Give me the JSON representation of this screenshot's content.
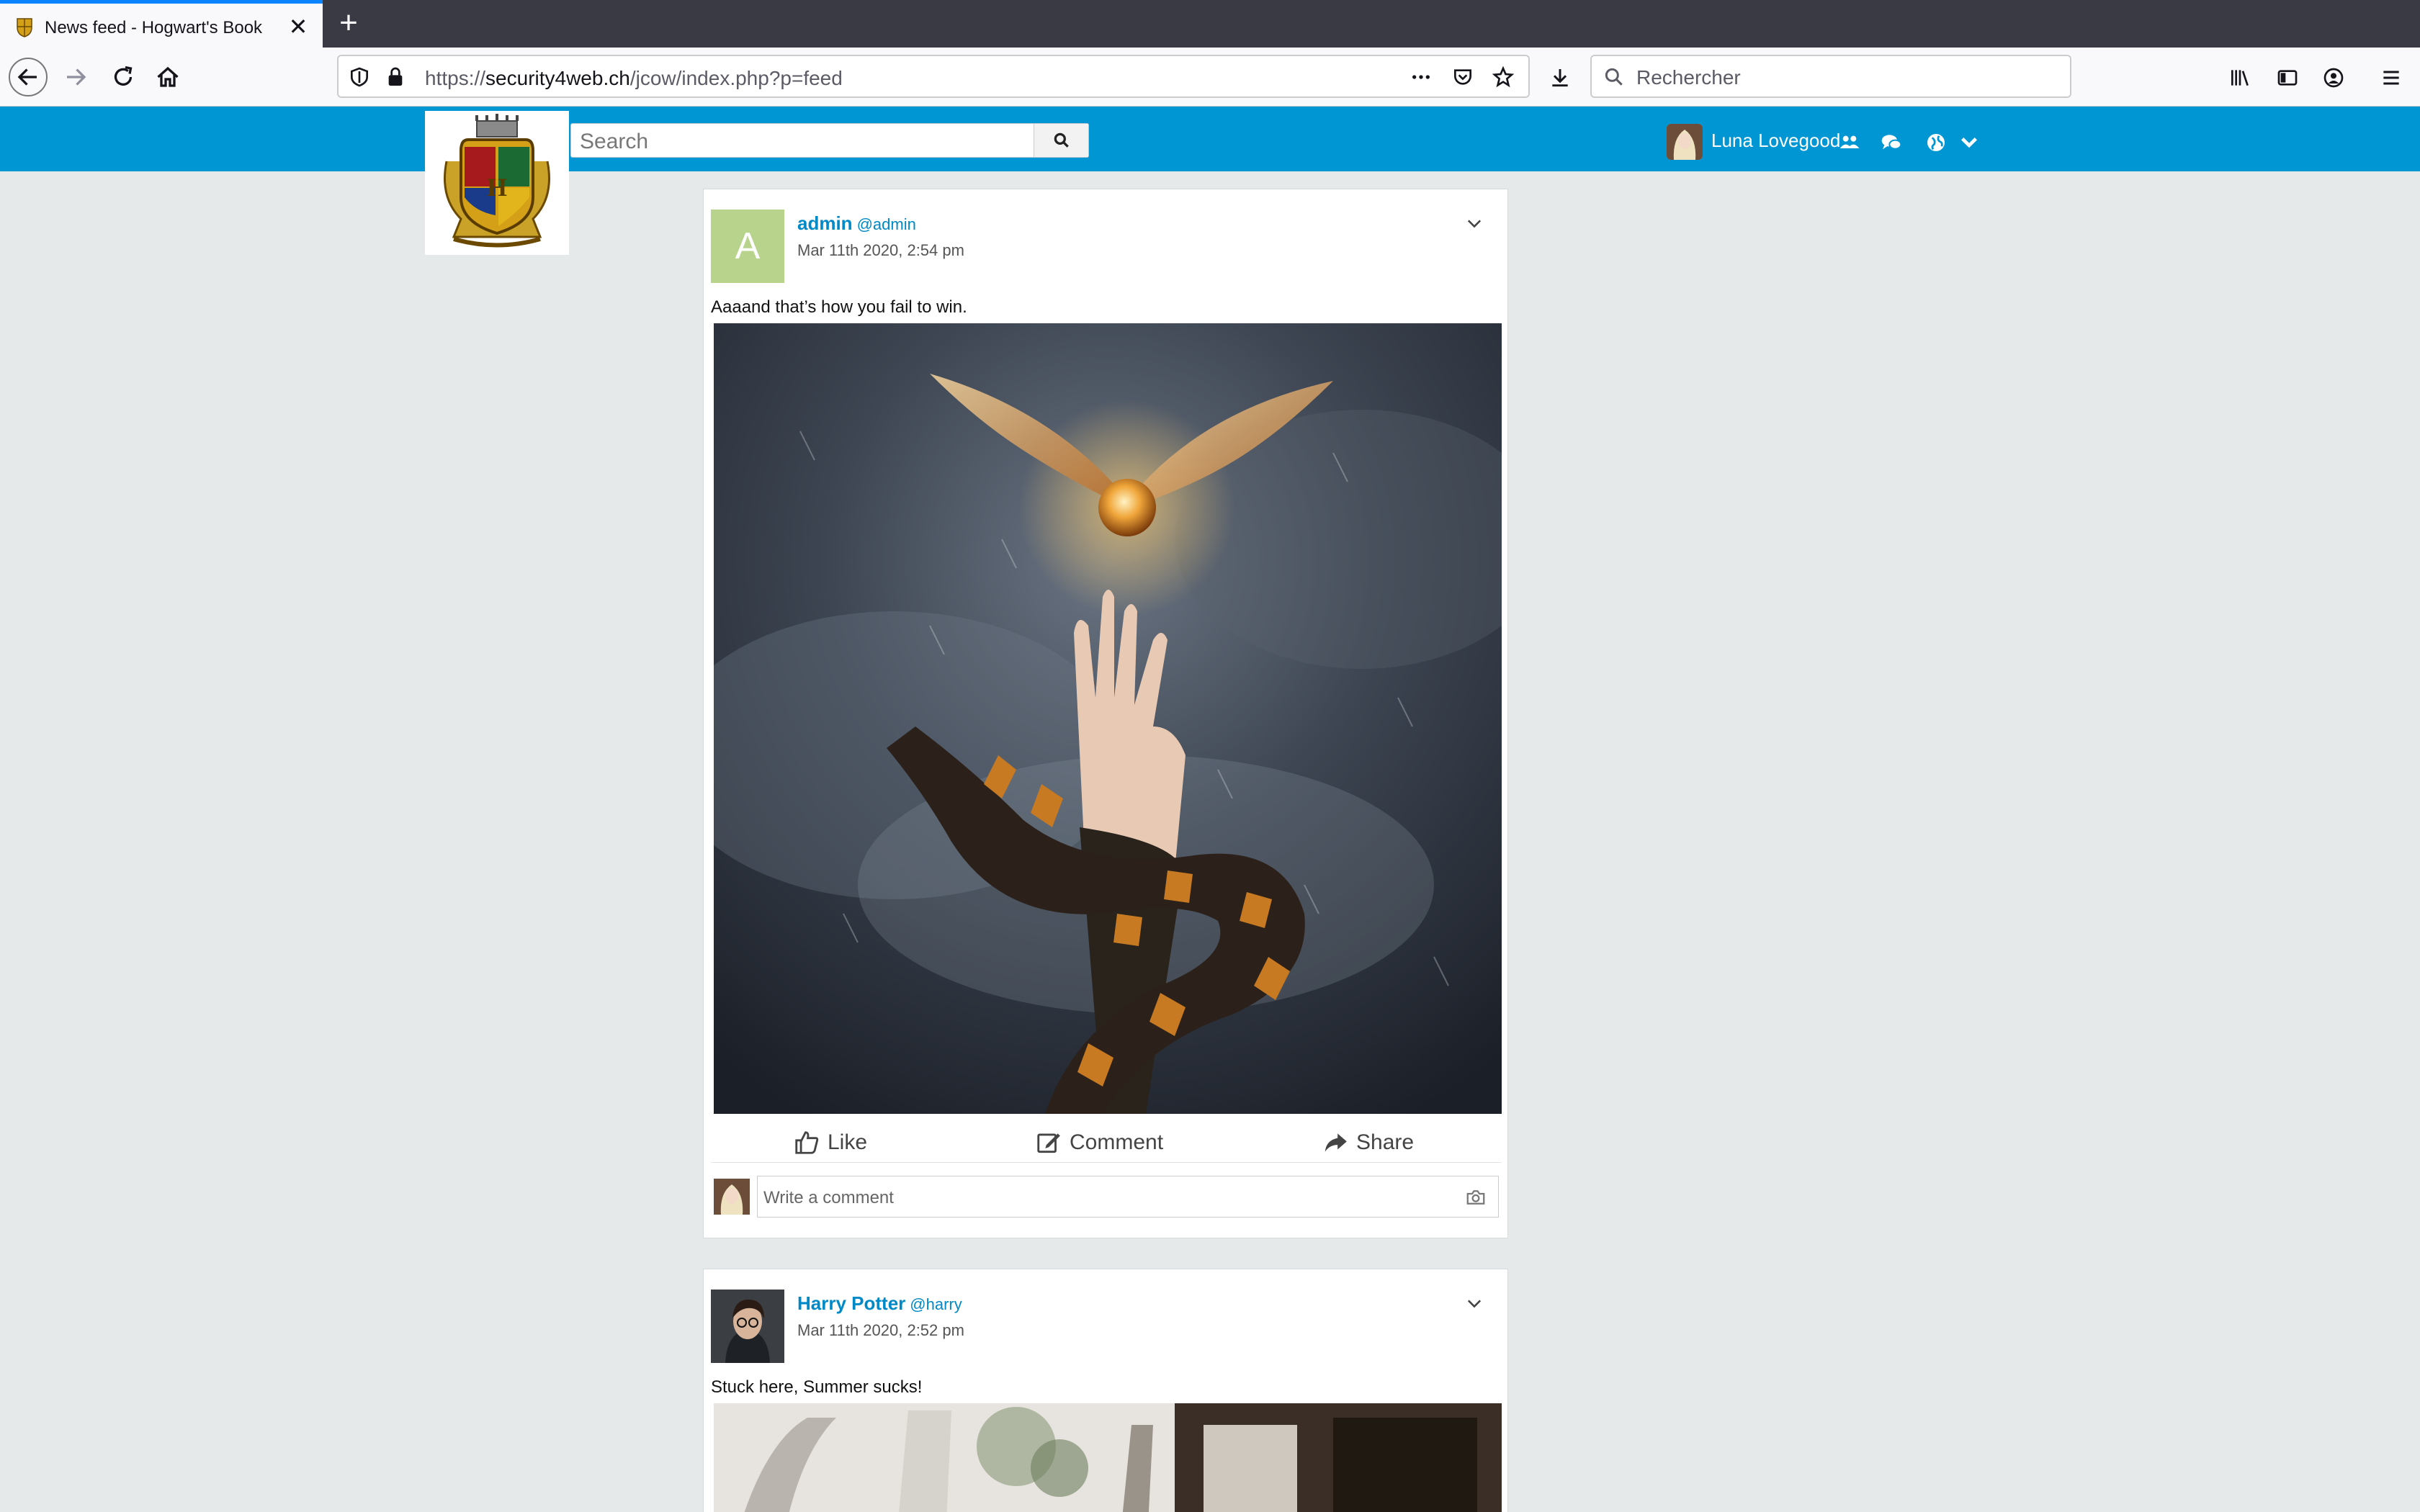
{
  "browser": {
    "tab_title": "News feed - Hogwart's Book",
    "url_scheme": "https://",
    "url_host": "security4web.ch",
    "url_path": "/jcow/index.php?p=feed",
    "search_placeholder": "Rechercher"
  },
  "site": {
    "search_placeholder": "Search",
    "user_name": "Luna Lovegood"
  },
  "posts": [
    {
      "avatar_letter": "A",
      "author": "admin",
      "handle": "@admin",
      "date": "Mar 11th 2020, 2:54 pm",
      "text": "Aaaand that’s how you fail to win."
    },
    {
      "author": "Harry Potter",
      "handle": "@harry",
      "date": "Mar 11th 2020, 2:52 pm",
      "text": "Stuck here, Summer sucks!"
    }
  ],
  "actions": {
    "like": "Like",
    "comment": "Comment",
    "share": "Share",
    "comment_placeholder": "Write a comment"
  },
  "colors": {
    "header": "#0096d3",
    "link": "#0089c7",
    "tab_accent": "#0a84ff"
  }
}
